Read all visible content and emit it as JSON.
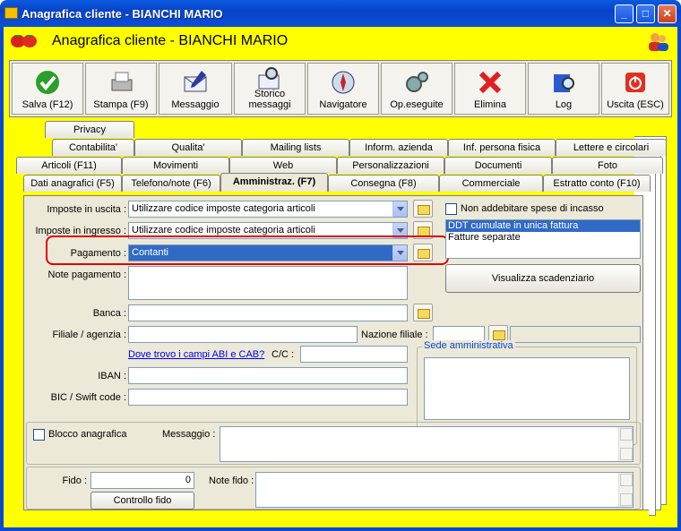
{
  "window": {
    "title": "Anagrafica cliente - BIANCHI MARIO"
  },
  "header": {
    "title": "Anagrafica cliente - BIANCHI MARIO"
  },
  "toolbar": [
    {
      "key": "salva",
      "label": "Salva (F12)",
      "icon": "checkmark-icon"
    },
    {
      "key": "stampa",
      "label": "Stampa (F9)",
      "icon": "printer-icon"
    },
    {
      "key": "messaggio",
      "label": "Messaggio",
      "icon": "envelope-pen-icon"
    },
    {
      "key": "storico",
      "label": "Storico\nmessaggi",
      "icon": "envelope-search-icon"
    },
    {
      "key": "navigatore",
      "label": "Navigatore",
      "icon": "compass-icon"
    },
    {
      "key": "opeseguite",
      "label": "Op.eseguite",
      "icon": "gears-icon"
    },
    {
      "key": "elimina",
      "label": "Elimina",
      "icon": "red-x-icon"
    },
    {
      "key": "log",
      "label": "Log",
      "icon": "book-search-icon"
    },
    {
      "key": "uscita",
      "label": "Uscita (ESC)",
      "icon": "power-icon"
    }
  ],
  "tabs": {
    "row1": [
      "Privacy"
    ],
    "row2": [
      "Contabilita'",
      "Qualita'",
      "Mailing lists",
      "Inform. azienda",
      "Inf. persona fisica",
      "Lettere e circolari"
    ],
    "row3": [
      "Articoli (F11)",
      "Movimenti",
      "Web",
      "Personalizzazioni",
      "Documenti",
      "Foto"
    ],
    "row4": [
      "Dati anagrafici (F5)",
      "Telefono/note (F6)",
      "Amministraz. (F7)",
      "Consegna (F8)",
      "Commerciale",
      "Estratto conto (F10)"
    ]
  },
  "form": {
    "imposte_uscita_label": "Imposte in uscita :",
    "imposte_uscita_value": "Utilizzare codice imposte categoria articoli",
    "imposte_ingresso_label": "Imposte in ingresso :",
    "imposte_ingresso_value": "Utilizzare codice imposte categoria articoli",
    "pagamento_label": "Pagamento :",
    "pagamento_value": "Contanti",
    "note_pagamento_label": "Note pagamento :",
    "banca_label": "Banca :",
    "filiale_label": "Filiale / agenzia :",
    "nazione_label": "Nazione filiale :",
    "abi_link": "Dove trovo i campi ABI e CAB?",
    "cc_label": "C/C :",
    "iban_label": "IBAN :",
    "bic_label": "BIC / Swift code :",
    "non_addebitare_label": "Non addebitare spese di incasso",
    "ddt_options": [
      "DDT cumulate in unica fattura",
      "Fatture separate"
    ],
    "ddt_selected": "DDT cumulate in unica fattura",
    "scadenziario_button": "Visualizza scadenziario",
    "sede_label": "Sede amministrativa",
    "blocco_label": "Blocco anagrafica",
    "messaggio_label": "Messaggio :",
    "fido_label": "Fido :",
    "fido_value": "0",
    "controllo_fido_button": "Controllo fido",
    "note_fido_label": "Note fido :"
  },
  "colors": {
    "background": "#ffff00",
    "highlight": "#e00000",
    "selection": "#316ac5"
  }
}
